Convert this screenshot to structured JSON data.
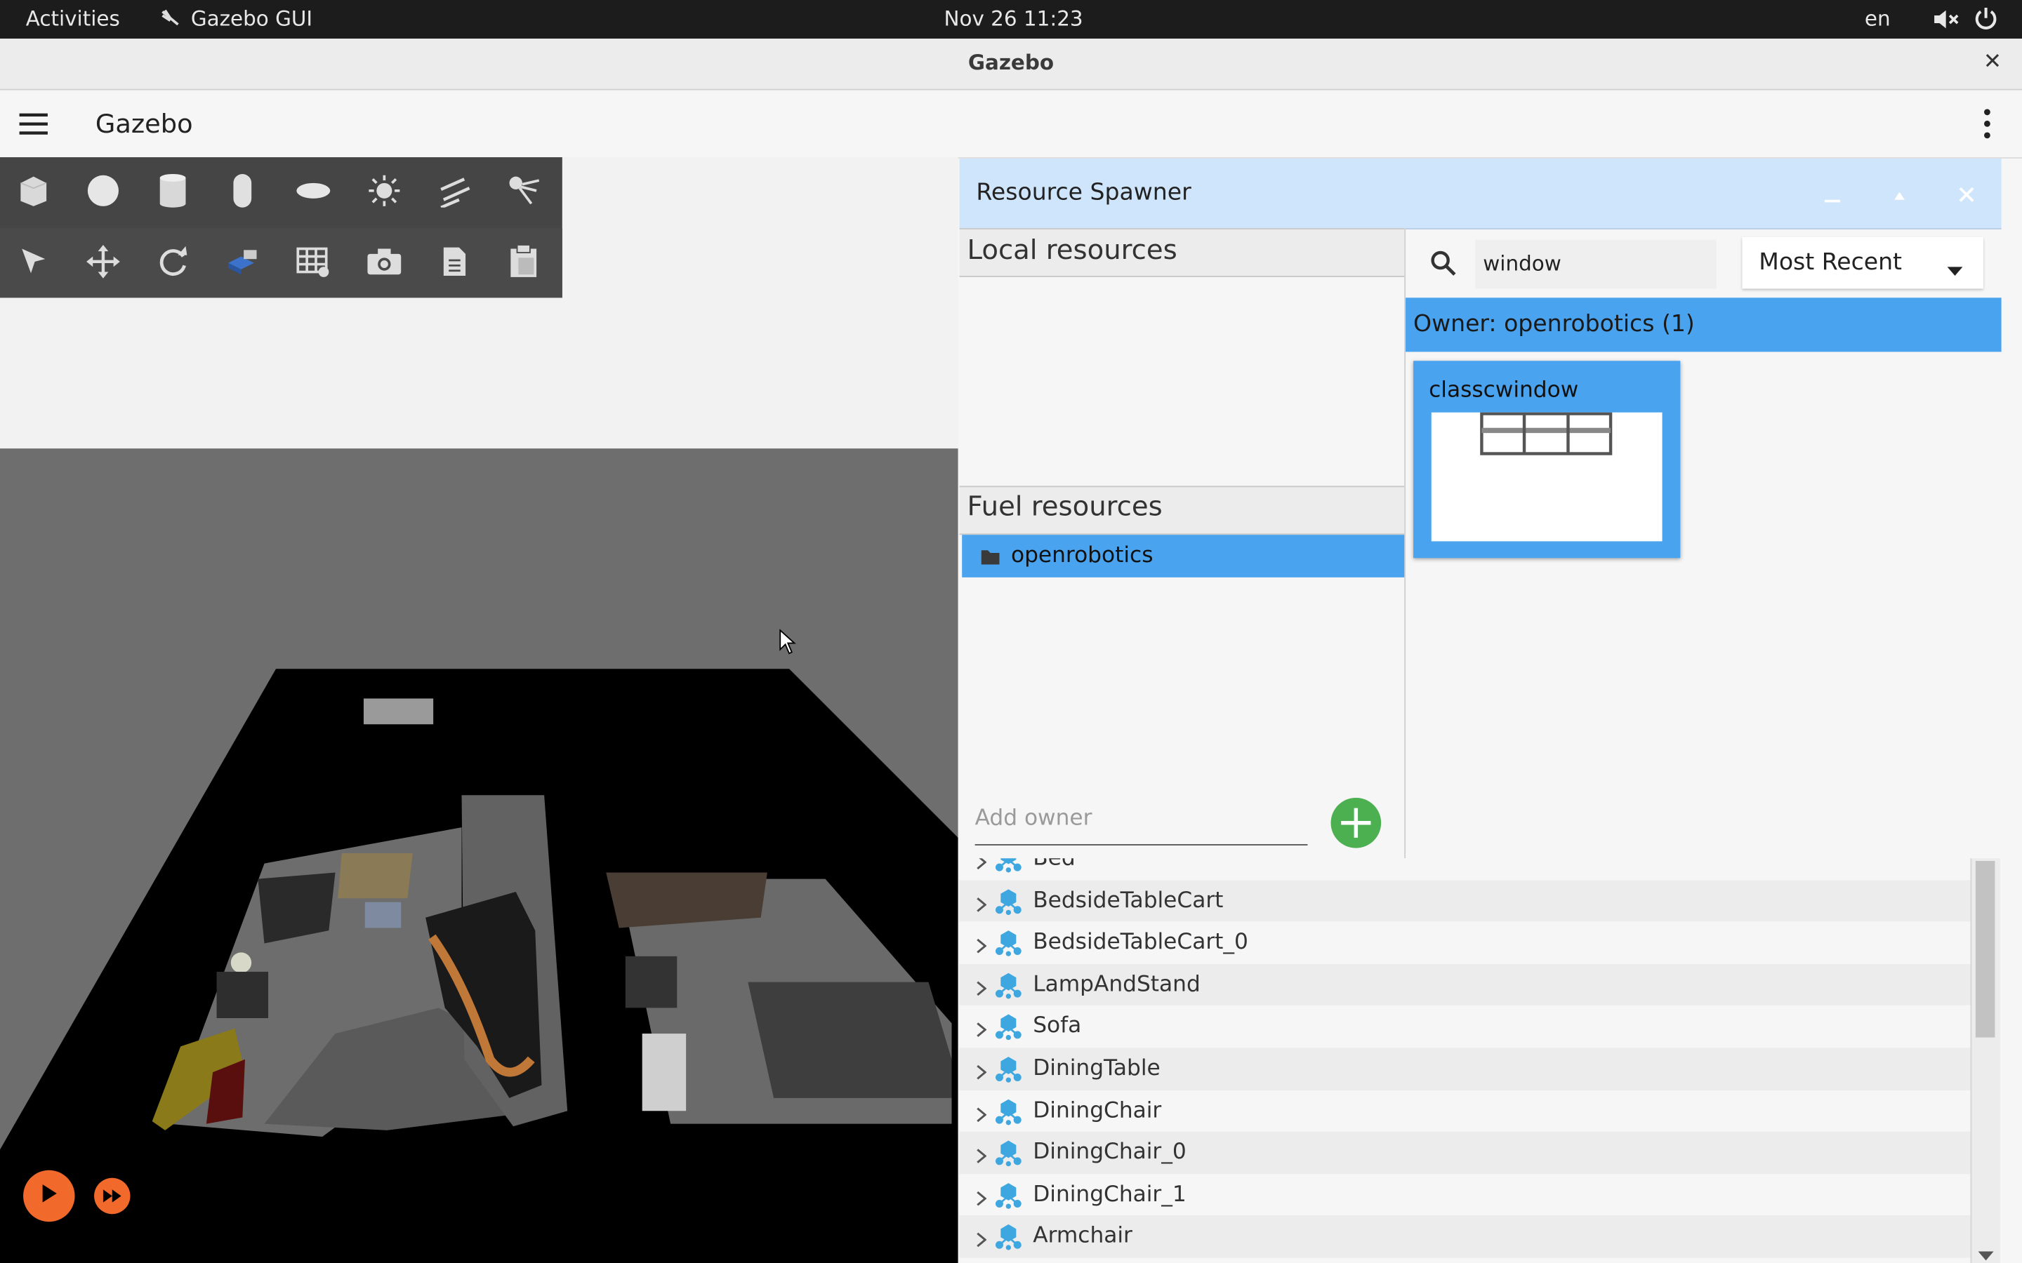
{
  "system_bar": {
    "activities": "Activities",
    "app_name": "Gazebo GUI",
    "clock": "Nov 26  11:23",
    "language": "en"
  },
  "window": {
    "title": "Gazebo",
    "close_glyph": "✕"
  },
  "app_bar": {
    "title": "Gazebo"
  },
  "toolbar": {
    "shapes": [
      "box-icon",
      "sphere-icon",
      "cylinder-icon",
      "capsule-icon",
      "ellipsoid-icon",
      "point-light-icon",
      "directional-light-icon",
      "spot-light-icon"
    ],
    "tools": [
      "select-icon",
      "translate-icon",
      "rotate-icon",
      "view-angle-icon",
      "grid-snap-icon",
      "screenshot-icon",
      "copy-icon",
      "paste-icon"
    ]
  },
  "resource_spawner": {
    "title": "Resource Spawner",
    "local_resources_label": "Local resources",
    "fuel_resources_label": "Fuel resources",
    "fuel_owner_item": "openrobotics",
    "add_owner_placeholder": "Add owner",
    "search_value": "window",
    "sort_selected": "Most Recent",
    "owner_header": "Owner: openrobotics (1)",
    "results": [
      {
        "name": "classcwindow"
      }
    ]
  },
  "entity_tree": {
    "items": [
      "Bed",
      "BedsideTableCart",
      "BedsideTableCart_0",
      "LampAndStand",
      "Sofa",
      "DiningTable",
      "DiningChair",
      "DiningChair_0",
      "DiningChair_1",
      "Armchair"
    ]
  },
  "colors": {
    "accent_blue": "#4aa3ef",
    "spawner_title_bg": "#cfe5fb",
    "play_orange": "#f26a2b",
    "add_green": "#4caf50",
    "model_icon_blue": "#3fa7e0"
  }
}
